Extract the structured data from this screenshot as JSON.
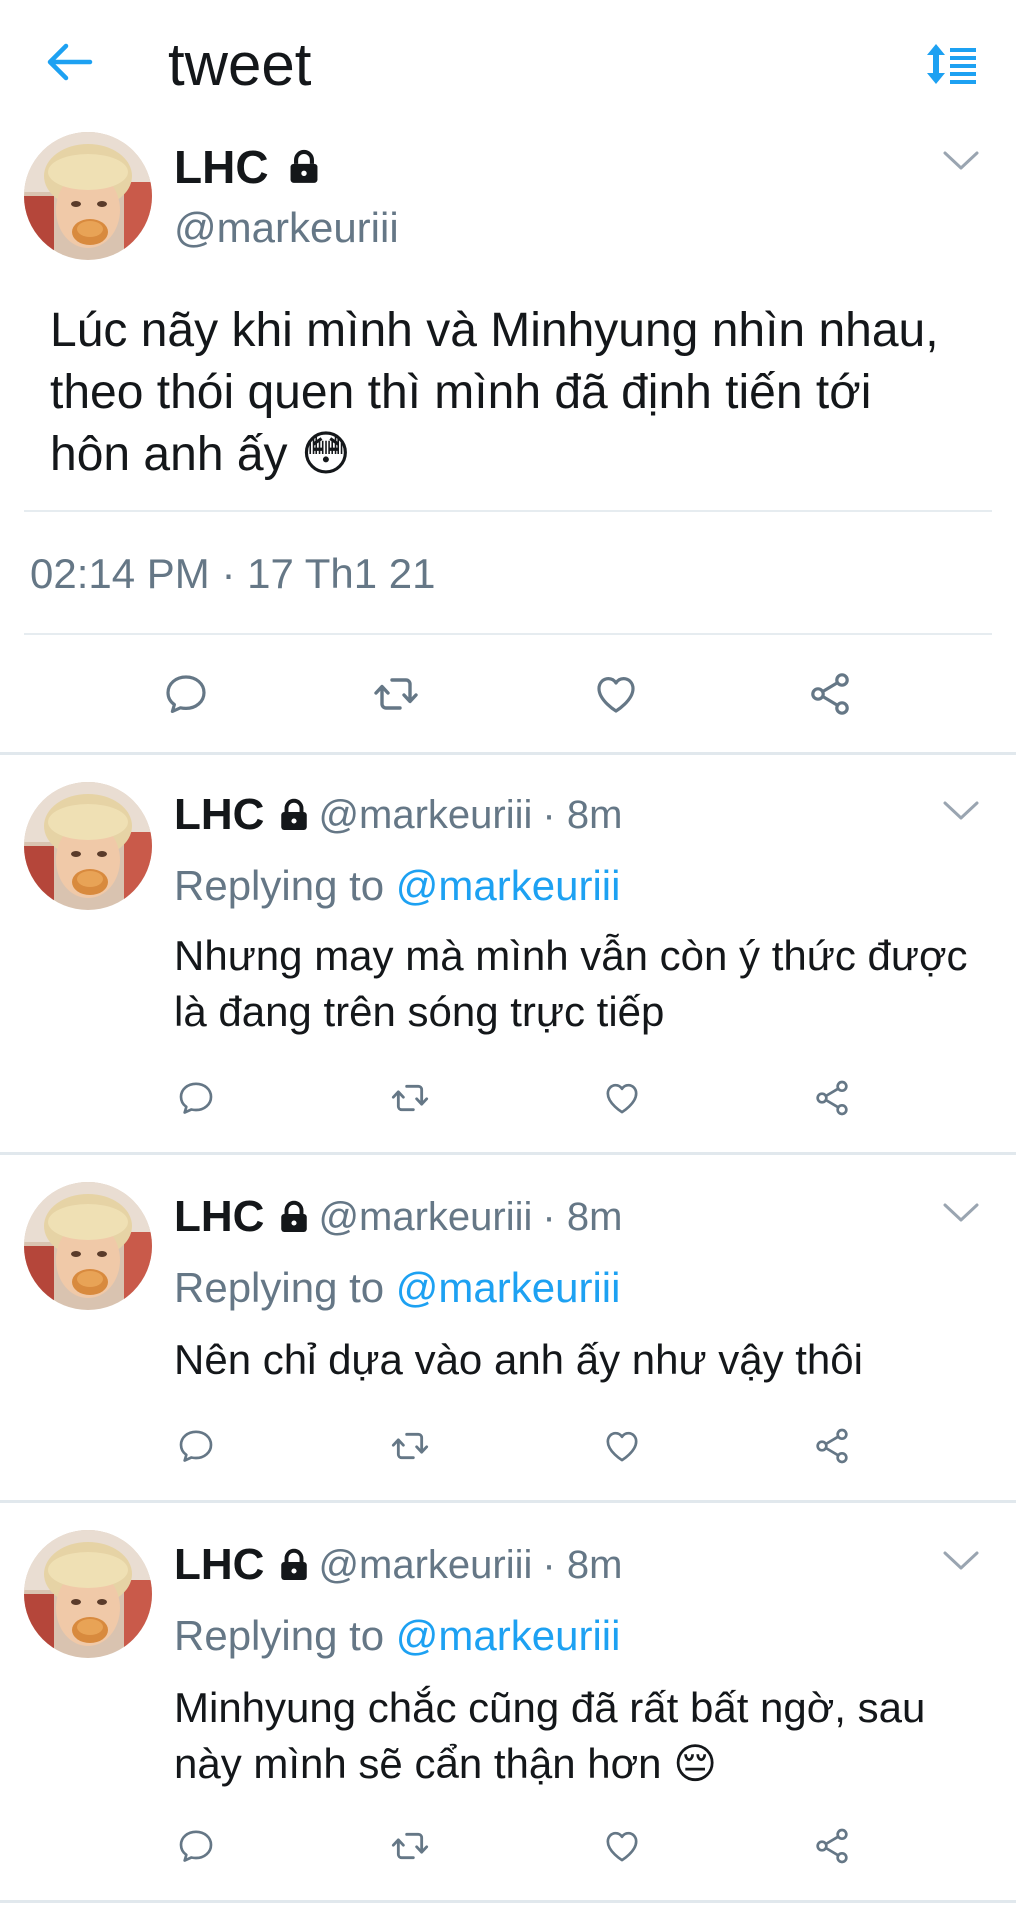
{
  "header": {
    "title": "tweet",
    "back_icon": "arrow-left-icon",
    "sort_icon": "sort-list-icon"
  },
  "colors": {
    "accent": "#1da1f2",
    "muted": "#657786",
    "text": "#14171a",
    "divider": "#e6ecf0"
  },
  "main_tweet": {
    "name": "LHC",
    "handle": "@markeuriii",
    "text": "Lúc nãy khi mình và Minhyung nhìn nhau, theo thói quen thì mình đã định tiến tới hôn anh ấy",
    "emoji": "😳",
    "timestamp": "02:14 PM · 17 Th1 21"
  },
  "replies": [
    {
      "name": "LHC",
      "handle": "@markeuriii",
      "time": "· 8m",
      "replying_prefix": "Replying to",
      "replying_to": "@markeuriii",
      "text": "Nhưng may mà mình vẫn còn ý thức được là đang trên sóng trực tiếp",
      "emoji": ""
    },
    {
      "name": "LHC",
      "handle": "@markeuriii",
      "time": "· 8m",
      "replying_prefix": "Replying to",
      "replying_to": "@markeuriii",
      "text": "Nên chỉ dựa vào anh ấy như vậy thôi",
      "emoji": ""
    },
    {
      "name": "LHC",
      "handle": "@markeuriii",
      "time": "· 8m",
      "replying_prefix": "Replying to",
      "replying_to": "@markeuriii",
      "text": "Minhyung chắc cũng đã rất bất ngờ, sau này mình sẽ cẩn thận hơn",
      "emoji": "😔"
    }
  ]
}
